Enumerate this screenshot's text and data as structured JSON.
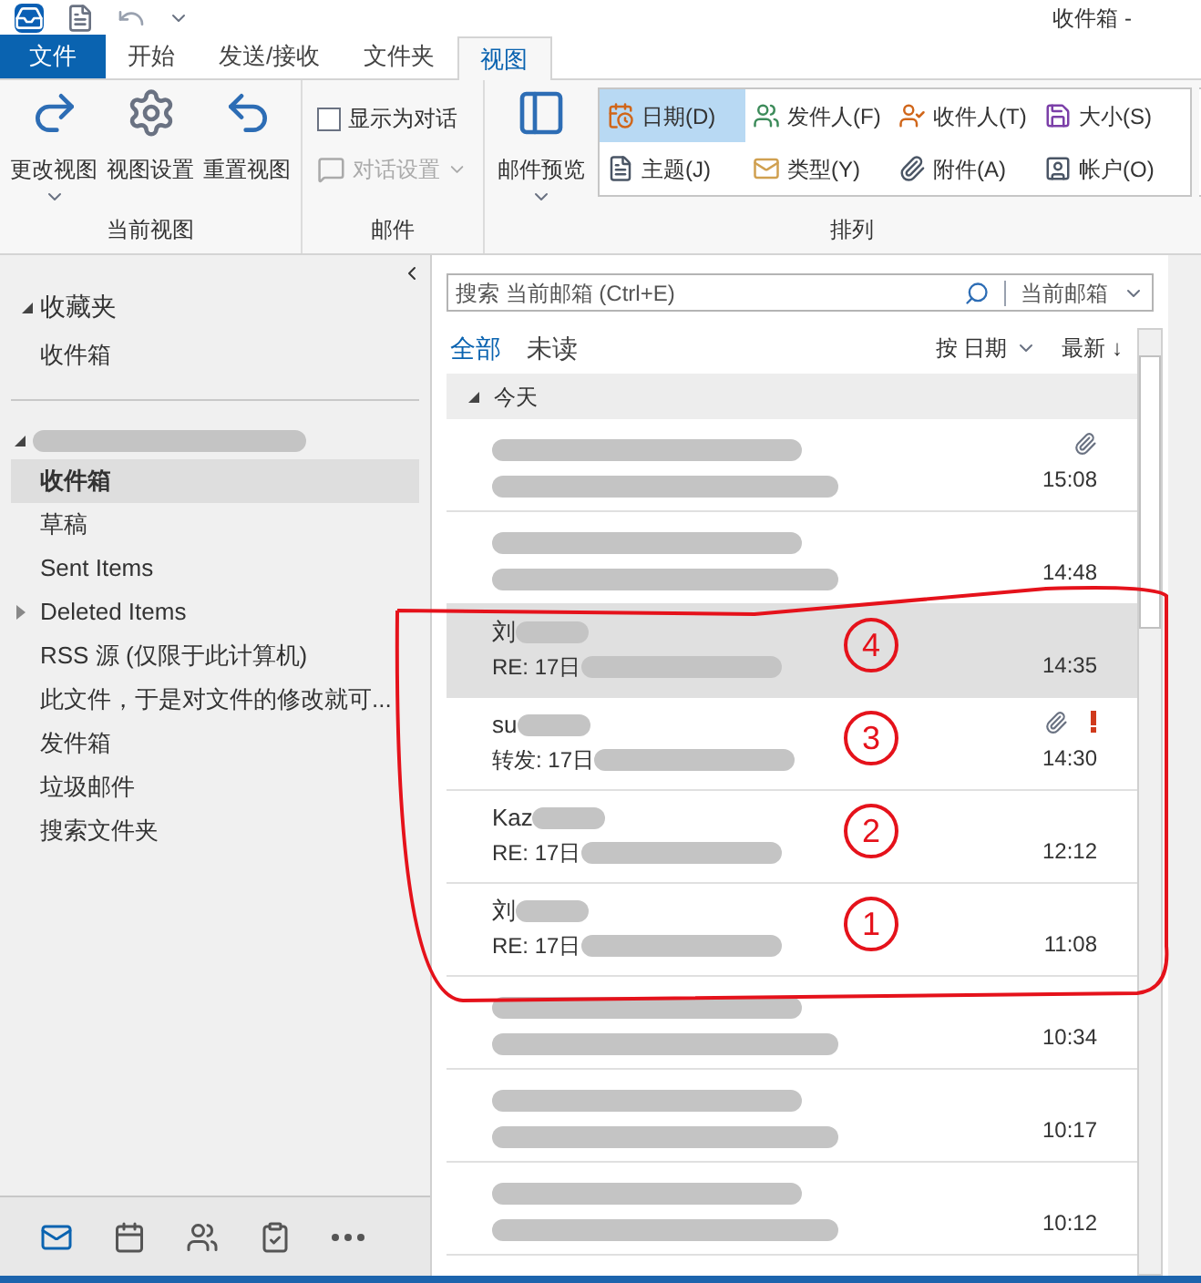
{
  "window": {
    "title": "收件箱 -"
  },
  "tabs": [
    {
      "label": "文件",
      "kind": "file",
      "selected": false
    },
    {
      "label": "开始",
      "kind": "tab",
      "selected": false
    },
    {
      "label": "发送/接收",
      "kind": "tab",
      "selected": false
    },
    {
      "label": "文件夹",
      "kind": "tab",
      "selected": false
    },
    {
      "label": "视图",
      "kind": "tab",
      "selected": true
    }
  ],
  "ribbon": {
    "current_view": {
      "buttons": [
        {
          "label": "更改视图",
          "kind": "change",
          "dropdown": true
        },
        {
          "label": "视图设置",
          "kind": "settings",
          "dropdown": false
        },
        {
          "label": "重置视图",
          "kind": "reset",
          "dropdown": false
        }
      ],
      "label": "当前视图"
    },
    "mail": {
      "checkbox": {
        "label": "显示为对话",
        "checked": false
      },
      "conversation_settings": {
        "label": "对话设置",
        "disabled": true
      },
      "label": "邮件"
    },
    "arrangement": {
      "preview": {
        "label": "邮件预览"
      },
      "options": [
        {
          "label": "日期(D)",
          "kind": "date",
          "selected": true
        },
        {
          "label": "发件人(F)",
          "kind": "from",
          "selected": false
        },
        {
          "label": "收件人(T)",
          "kind": "to",
          "selected": false
        },
        {
          "label": "大小(S)",
          "kind": "size",
          "selected": false
        },
        {
          "label": "主题(J)",
          "kind": "subject",
          "selected": false
        },
        {
          "label": "类型(Y)",
          "kind": "type",
          "selected": false
        },
        {
          "label": "附件(A)",
          "kind": "attachment",
          "selected": false
        },
        {
          "label": "帐户(O)",
          "kind": "account",
          "selected": false
        }
      ],
      "label": "排列"
    }
  },
  "folder_pane": {
    "favorites": {
      "title": "收藏夹",
      "expanded": true,
      "items": [
        {
          "label": "收件箱",
          "selected": false
        }
      ]
    },
    "account": {
      "expanded": true,
      "folders": [
        {
          "label": "收件箱",
          "selected": true,
          "has_children": false
        },
        {
          "label": "草稿",
          "selected": false,
          "has_children": false
        },
        {
          "label": "Sent Items",
          "selected": false,
          "has_children": false
        },
        {
          "label": "Deleted Items",
          "selected": false,
          "has_children": true
        },
        {
          "label": "RSS 源 (仅限于此计算机)",
          "selected": false,
          "has_children": false
        },
        {
          "label": "此文件，于是对文件的修改就可...",
          "selected": false,
          "has_children": false
        },
        {
          "label": "发件箱",
          "selected": false,
          "has_children": false
        },
        {
          "label": "垃圾邮件",
          "selected": false,
          "has_children": false
        },
        {
          "label": "搜索文件夹",
          "selected": false,
          "has_children": false
        }
      ]
    }
  },
  "search": {
    "placeholder": "搜索 当前邮箱 (Ctrl+E)",
    "scope": "当前邮箱"
  },
  "filters": [
    {
      "label": "全部",
      "selected": true
    },
    {
      "label": "未读",
      "selected": false
    }
  ],
  "sort": {
    "field": "按 日期",
    "order": "最新 ↓"
  },
  "group": {
    "title": "今天",
    "expanded": true
  },
  "messages": [
    {
      "time": "15:08",
      "attachment": true,
      "important": false,
      "selected": false
    },
    {
      "time": "14:48",
      "attachment": false,
      "important": false,
      "selected": false
    },
    {
      "sender": "刘",
      "subject": "RE: 17日",
      "time": "14:35",
      "attachment": false,
      "important": false,
      "selected": true,
      "mark": "4"
    },
    {
      "sender": "su",
      "subject": "转发: 17日",
      "time": "14:30",
      "attachment": true,
      "important": true,
      "selected": false,
      "mark": "3"
    },
    {
      "sender": "Kaz",
      "subject": "RE: 17日",
      "time": "12:12",
      "attachment": false,
      "important": false,
      "selected": false,
      "mark": "2"
    },
    {
      "sender": "刘",
      "subject": "RE: 17日",
      "time": "11:08",
      "attachment": false,
      "important": false,
      "selected": false,
      "mark": "1"
    },
    {
      "time": "10:34",
      "attachment": false,
      "important": false,
      "selected": false
    },
    {
      "time": "10:17",
      "attachment": false,
      "important": false,
      "selected": false
    },
    {
      "time": "10:12",
      "attachment": false,
      "important": false,
      "selected": false
    }
  ],
  "bottom_nav": [
    {
      "kind": "mail",
      "selected": true
    },
    {
      "kind": "calendar",
      "selected": false
    },
    {
      "kind": "people",
      "selected": false
    },
    {
      "kind": "tasks",
      "selected": false
    },
    {
      "kind": "more",
      "selected": false
    }
  ]
}
